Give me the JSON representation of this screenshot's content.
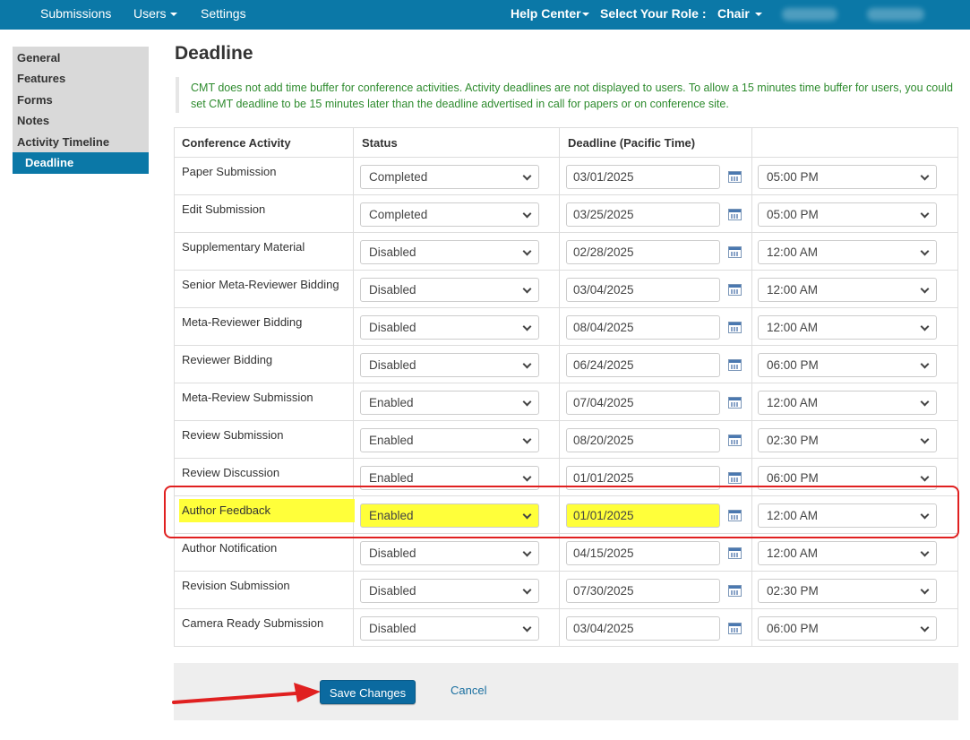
{
  "nav": {
    "submissions": "Submissions",
    "users": "Users",
    "settings": "Settings",
    "help_center": "Help Center",
    "select_role_label": "Select Your Role :",
    "role": "Chair"
  },
  "sidebar": {
    "items": [
      "General",
      "Features",
      "Forms",
      "Notes",
      "Activity Timeline"
    ],
    "active": "Deadline"
  },
  "page": {
    "title": "Deadline",
    "notice": "CMT does not add time buffer for conference activities. Activity deadlines are not displayed to users. To allow a 15 minutes time buffer for users, you could set CMT deadline to be 15 minutes later than the deadline advertised in call for papers or on conference site."
  },
  "table": {
    "headers": [
      "Conference Activity",
      "Status",
      "Deadline (Pacific Time)"
    ],
    "rows": [
      {
        "activity": "Paper Submission",
        "status": "Completed",
        "date": "03/01/2025",
        "time": "05:00 PM"
      },
      {
        "activity": "Edit Submission",
        "status": "Completed",
        "date": "03/25/2025",
        "time": "05:00 PM"
      },
      {
        "activity": "Supplementary Material",
        "status": "Disabled",
        "date": "02/28/2025",
        "time": "12:00 AM"
      },
      {
        "activity": "Senior Meta-Reviewer Bidding",
        "status": "Disabled",
        "date": "03/04/2025",
        "time": "12:00 AM"
      },
      {
        "activity": "Meta-Reviewer Bidding",
        "status": "Disabled",
        "date": "08/04/2025",
        "time": "12:00 AM"
      },
      {
        "activity": "Reviewer Bidding",
        "status": "Disabled",
        "date": "06/24/2025",
        "time": "06:00 PM"
      },
      {
        "activity": "Meta-Review Submission",
        "status": "Enabled",
        "date": "07/04/2025",
        "time": "12:00 AM"
      },
      {
        "activity": "Review Submission",
        "status": "Enabled",
        "date": "08/20/2025",
        "time": "02:30 PM"
      },
      {
        "activity": "Review Discussion",
        "status": "Enabled",
        "date": "01/01/2025",
        "time": "06:00 PM"
      },
      {
        "activity": "Author Feedback",
        "status": "Enabled",
        "date": "01/01/2025",
        "time": "12:00 AM",
        "highlighted": true
      },
      {
        "activity": "Author Notification",
        "status": "Disabled",
        "date": "04/15/2025",
        "time": "12:00 AM"
      },
      {
        "activity": "Revision Submission",
        "status": "Disabled",
        "date": "07/30/2025",
        "time": "02:30 PM"
      },
      {
        "activity": "Camera Ready Submission",
        "status": "Disabled",
        "date": "03/04/2025",
        "time": "06:00 PM"
      }
    ]
  },
  "footer": {
    "save_label": "Save Changes",
    "cancel_label": "Cancel"
  },
  "colors": {
    "nav_bg": "#0b78a7",
    "notice_text": "#2e8b2e",
    "highlight": "#ffff3a",
    "annotation_red": "#e02020"
  },
  "icons": {
    "calendar": "calendar-icon",
    "dropdown": "chevron-down-icon",
    "annotation": "red-arrow"
  }
}
